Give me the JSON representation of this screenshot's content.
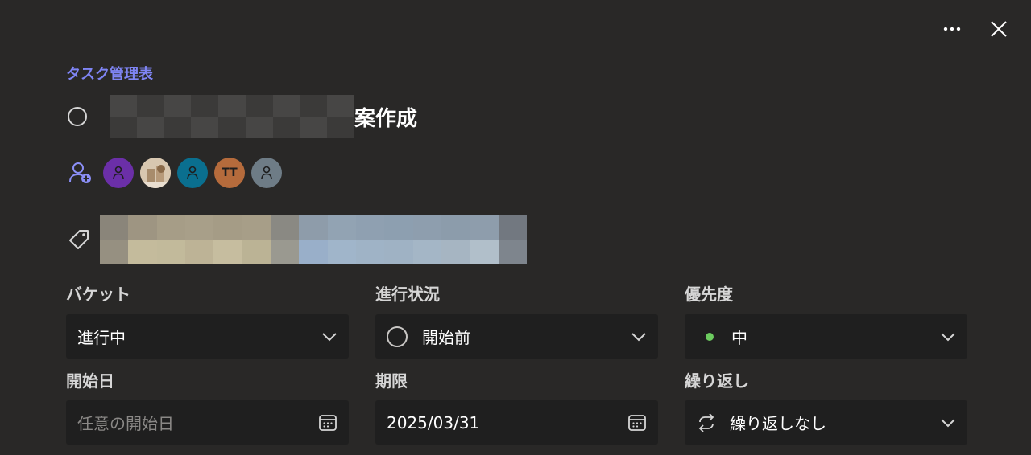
{
  "header": {
    "more_icon": "more-horizontal-icon",
    "close_icon": "close-icon"
  },
  "plan_name": "タスク管理表",
  "task": {
    "title_suffix": "案作成"
  },
  "assignees": [
    {
      "initials": "",
      "color": "#6b2fa8",
      "type": "person-icon"
    },
    {
      "initials": "",
      "color": "#c9b49a",
      "type": "photo"
    },
    {
      "initials": "",
      "color": "#0a6f8f",
      "type": "person-icon"
    },
    {
      "initials": "TT",
      "color": "#b56b3c",
      "type": "initials"
    },
    {
      "initials": "",
      "color": "#6e7c86",
      "type": "person-icon"
    }
  ],
  "fields": {
    "bucket": {
      "label": "バケット",
      "value": "進行中"
    },
    "progress": {
      "label": "進行状況",
      "value": "開始前"
    },
    "priority": {
      "label": "優先度",
      "value": "中",
      "dot_color": "#6ccb5f"
    },
    "start_date": {
      "label": "開始日",
      "placeholder": "任意の開始日"
    },
    "due_date": {
      "label": "期限",
      "value": "2025/03/31"
    },
    "repeat": {
      "label": "繰り返し",
      "value": "繰り返しなし"
    }
  }
}
